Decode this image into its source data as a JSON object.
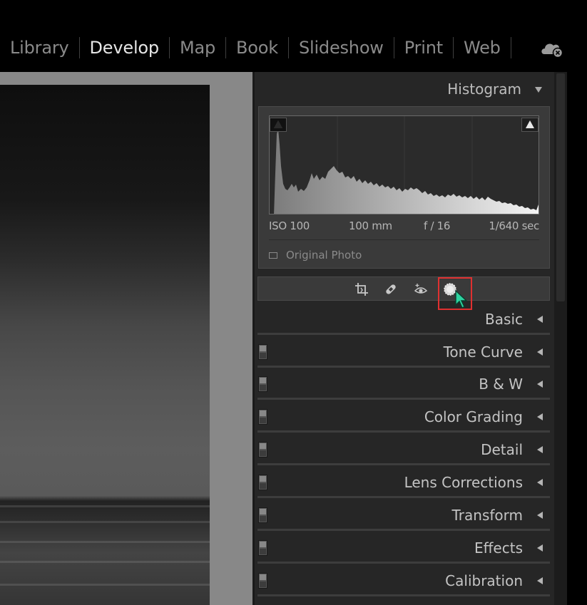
{
  "modules": {
    "items": [
      {
        "label": "Library",
        "active": false
      },
      {
        "label": "Develop",
        "active": true
      },
      {
        "label": "Map",
        "active": false
      },
      {
        "label": "Book",
        "active": false
      },
      {
        "label": "Slideshow",
        "active": false
      },
      {
        "label": "Print",
        "active": false
      },
      {
        "label": "Web",
        "active": false
      }
    ],
    "cloud_icon": "cloud-sync-error-icon"
  },
  "histogram": {
    "title": "Histogram",
    "exif": {
      "iso": "ISO 100",
      "focal_length": "100 mm",
      "aperture": "f / 16",
      "shutter": "1/640 sec"
    },
    "original_photo_label": "Original Photo"
  },
  "tools": [
    {
      "name": "crop-icon"
    },
    {
      "name": "healing-icon"
    },
    {
      "name": "red-eye-icon"
    },
    {
      "name": "masking-icon"
    }
  ],
  "sections": {
    "basic": "Basic",
    "tone_curve": "Tone Curve",
    "bw": "B & W",
    "color_grading": "Color Grading",
    "detail": "Detail",
    "lens_corrections": "Lens Corrections",
    "transform": "Transform",
    "effects": "Effects",
    "calibration": "Calibration"
  },
  "colors": {
    "panel_bg": "#262626",
    "highlight_border": "#e03030",
    "cursor": "#2ed3a0"
  }
}
